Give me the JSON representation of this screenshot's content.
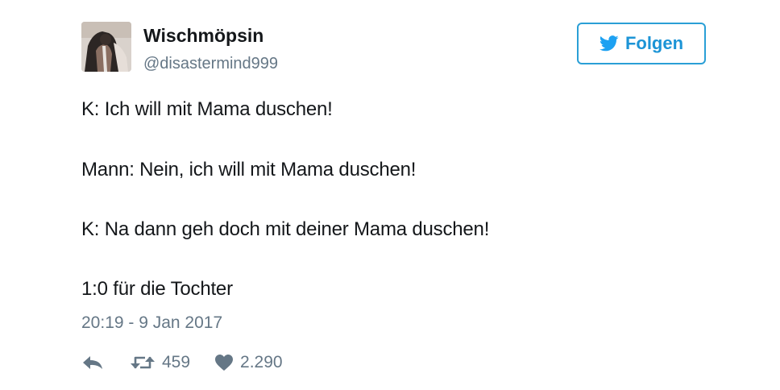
{
  "author": {
    "display_name": "Wischmöpsin",
    "handle": "@disastermind999"
  },
  "follow_button": {
    "label": "Folgen",
    "icon": "twitter-bird-icon",
    "color": "#1da1f2"
  },
  "tweet": {
    "lines": [
      "K: Ich will mit Mama duschen!",
      "Mann: Nein, ich will mit Mama duschen!",
      "K: Na dann geh doch mit deiner Mama duschen!",
      "1:0 für die Tochter"
    ],
    "timestamp": "20:19 - 9 Jan 2017"
  },
  "actions": {
    "reply_icon": "reply-icon",
    "retweet_icon": "retweet-icon",
    "retweet_count": "459",
    "like_icon": "heart-icon",
    "like_count": "2.290"
  }
}
